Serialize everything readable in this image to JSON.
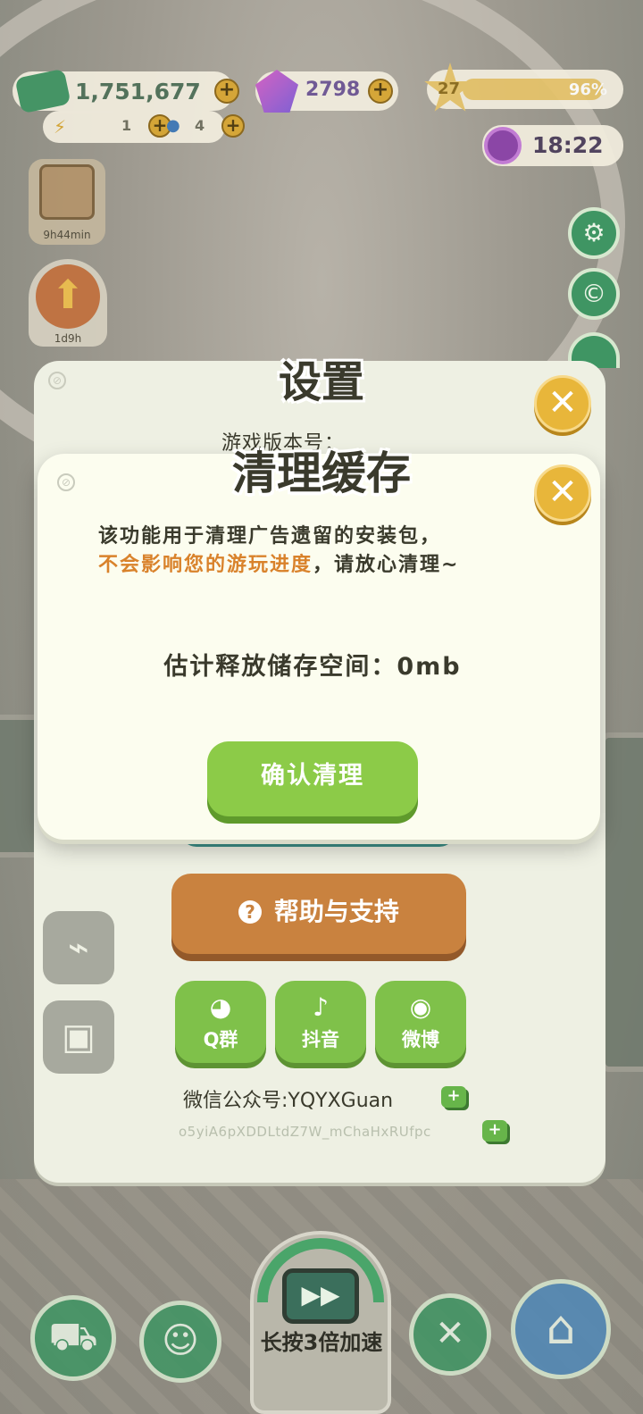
{
  "hud": {
    "cash": "1,751,677",
    "gems": "2798",
    "level": "27",
    "level_progress": "96%",
    "level_progress_value": 0.96,
    "energy": "1",
    "water": "4",
    "clock": "18:22",
    "book_timer": "9h44min",
    "boost_timer": "1d9h"
  },
  "settings": {
    "title": "设置",
    "version_partial": "游戏版本号：",
    "help_label": "帮助与支持",
    "help_icon": "?",
    "social": [
      {
        "label": "Q群",
        "icon": "qq-icon"
      },
      {
        "label": "抖音",
        "icon": "douyin-icon"
      },
      {
        "label": "微博",
        "icon": "weibo-icon"
      }
    ],
    "wechat": "微信公众号:YQYXGuan",
    "user_code": "o5yiA6pXDDLtdZ7W_mChaHxRUfpc"
  },
  "cache_dialog": {
    "title": "清理缓存",
    "line1": "该功能用于清理广告遗留的安装包，",
    "line2_highlight": "不会影响您的游玩进度",
    "line2_rest": "，请放心清理~",
    "space_label": "估计释放储存空间：0mb",
    "confirm_label": "确认清理"
  },
  "bottom_bar": {
    "speed_label": "长按3倍加速"
  },
  "colors": {
    "accent_green": "#8ccb48",
    "close_yellow": "#e8b63a",
    "help_orange": "#c9823f",
    "highlight_orange": "#d9822b",
    "dark_text": "#3a3a2c"
  }
}
